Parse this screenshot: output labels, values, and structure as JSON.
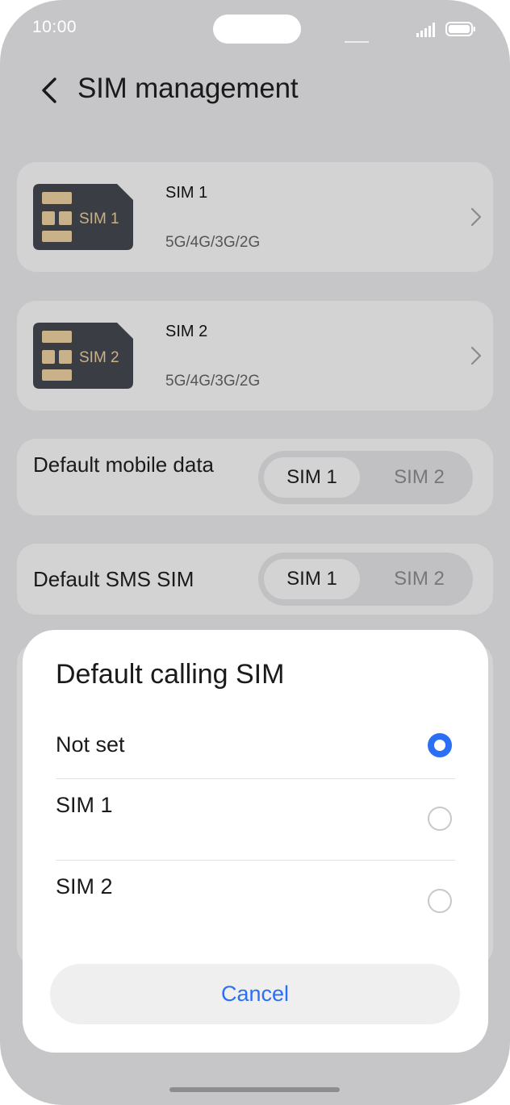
{
  "status": {
    "time": "10:00"
  },
  "header": {
    "title": "SIM management"
  },
  "sims": [
    {
      "card_label": "SIM 1",
      "name": "SIM 1",
      "network": "5G/4G/3G/2G"
    },
    {
      "card_label": "SIM 2",
      "name": "SIM 2",
      "network": "5G/4G/3G/2G"
    }
  ],
  "default_mobile_data": {
    "label": "Default mobile data",
    "options": [
      "SIM 1",
      "SIM 2"
    ],
    "selected": "SIM 1"
  },
  "default_sms": {
    "label": "Default SMS SIM",
    "options": [
      "SIM 1",
      "SIM 2"
    ],
    "selected": "SIM 1"
  },
  "dialog": {
    "title": "Default calling SIM",
    "options": [
      {
        "label": "Not set",
        "selected": true
      },
      {
        "label": "SIM 1",
        "selected": false
      },
      {
        "label": "SIM 2",
        "selected": false
      }
    ],
    "cancel": "Cancel"
  },
  "colors": {
    "accent": "#2b6ff5",
    "dim_background": "#c6c6c8",
    "sim_chip": "#c9b28a",
    "sim_body": "#3b3d44"
  },
  "icons": {
    "back": "back-arrow-icon",
    "chevron": "chevron-right-icon",
    "signal": "signal-icon",
    "battery": "battery-icon"
  }
}
